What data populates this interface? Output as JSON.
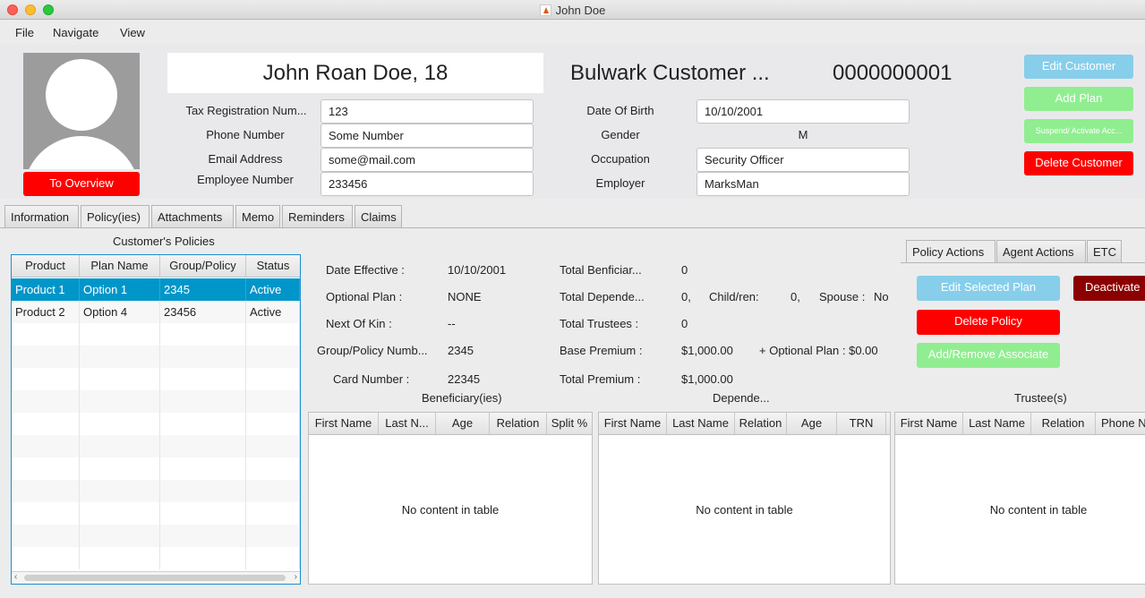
{
  "window": {
    "title": "John Doe"
  },
  "menu": [
    "File",
    "Navigate",
    "View"
  ],
  "customer": {
    "display_name": "John Roan Doe, 18",
    "company": "Bulwark Customer ...",
    "id": "0000000001"
  },
  "buttons": {
    "to_overview": "To Overview",
    "edit_customer": "Edit Customer",
    "add_plan": "Add Plan",
    "suspend_activate": "Suspend/ Activate Acc...",
    "delete_customer": "Delete Customer",
    "edit_selected_plan": "Edit Selected Plan",
    "deactivate": "Deactivate",
    "delete_policy": "Delete Policy",
    "add_remove_associate": "Add/Remove Associate"
  },
  "fields_left": [
    {
      "label": "Tax Registration Num...",
      "value": "123"
    },
    {
      "label": "Phone Number",
      "value": "Some Number"
    },
    {
      "label": "Email Address",
      "value": "some@mail.com"
    },
    {
      "label": "Employee Number",
      "value": "233456"
    }
  ],
  "fields_right": {
    "dob_label": "Date Of Birth",
    "dob_value": "10/10/2001",
    "gender_label": "Gender",
    "gender_value": "M",
    "occupation_label": "Occupation",
    "occupation_value": "Security Officer",
    "employer_label": "Employer",
    "employer_value": "MarksMan"
  },
  "tabs": [
    "Information",
    "Policy(ies)",
    "Attachments",
    "Memo",
    "Reminders",
    "Claims"
  ],
  "policies": {
    "title": "Customer's Policies",
    "columns": [
      "Product",
      "Plan Name",
      "Group/Policy",
      "Status"
    ],
    "rows": [
      [
        "Product 1",
        "Option 1",
        "2345",
        "Active"
      ],
      [
        "Product 2",
        "Option 4",
        "23456",
        "Active"
      ]
    ]
  },
  "policy_details": {
    "date_effective_label": "Date Effective :",
    "date_effective": "10/10/2001",
    "optional_plan_label": "Optional Plan :",
    "optional_plan": "NONE",
    "next_of_kin_label": "Next Of Kin :",
    "next_of_kin": "--",
    "group_policy_label": "Group/Policy Numb...",
    "group_policy": "2345",
    "card_number_label": "Card Number  :",
    "card_number": "22345",
    "total_beneficiaries_label": "Total Benficiar...",
    "total_beneficiaries": "0",
    "total_dependents_label": "Total Depende...",
    "total_dependents": "0,",
    "children_label": "Child/ren:",
    "children": "0,",
    "spouse_label": "Spouse :",
    "spouse": "No",
    "total_trustees_label": "Total Trustees :",
    "total_trustees": "0",
    "base_premium_label": "Base Premium :",
    "base_premium": "$1,000.00",
    "optional_plan_premium": "+  Optional Plan : $0.00",
    "total_premium_label": "Total Premium :",
    "total_premium": "$1,000.00"
  },
  "right_tabs": [
    "Policy Actions",
    "Agent Actions",
    "ETC"
  ],
  "beneficiaries": {
    "title": "Beneficiary(ies)",
    "columns": [
      "First Name",
      "Last N...",
      "Age",
      "Relation",
      "Split %"
    ],
    "empty": "No content in table"
  },
  "dependents": {
    "title": "Depende...",
    "columns": [
      "First Name",
      "Last Name",
      "Relation",
      "Age",
      "TRN"
    ],
    "empty": "No content in table"
  },
  "trustees": {
    "title": "Trustee(s)",
    "columns": [
      "First Name",
      "Last Name",
      "Relation",
      "Phone N"
    ],
    "empty": "No content in table"
  }
}
